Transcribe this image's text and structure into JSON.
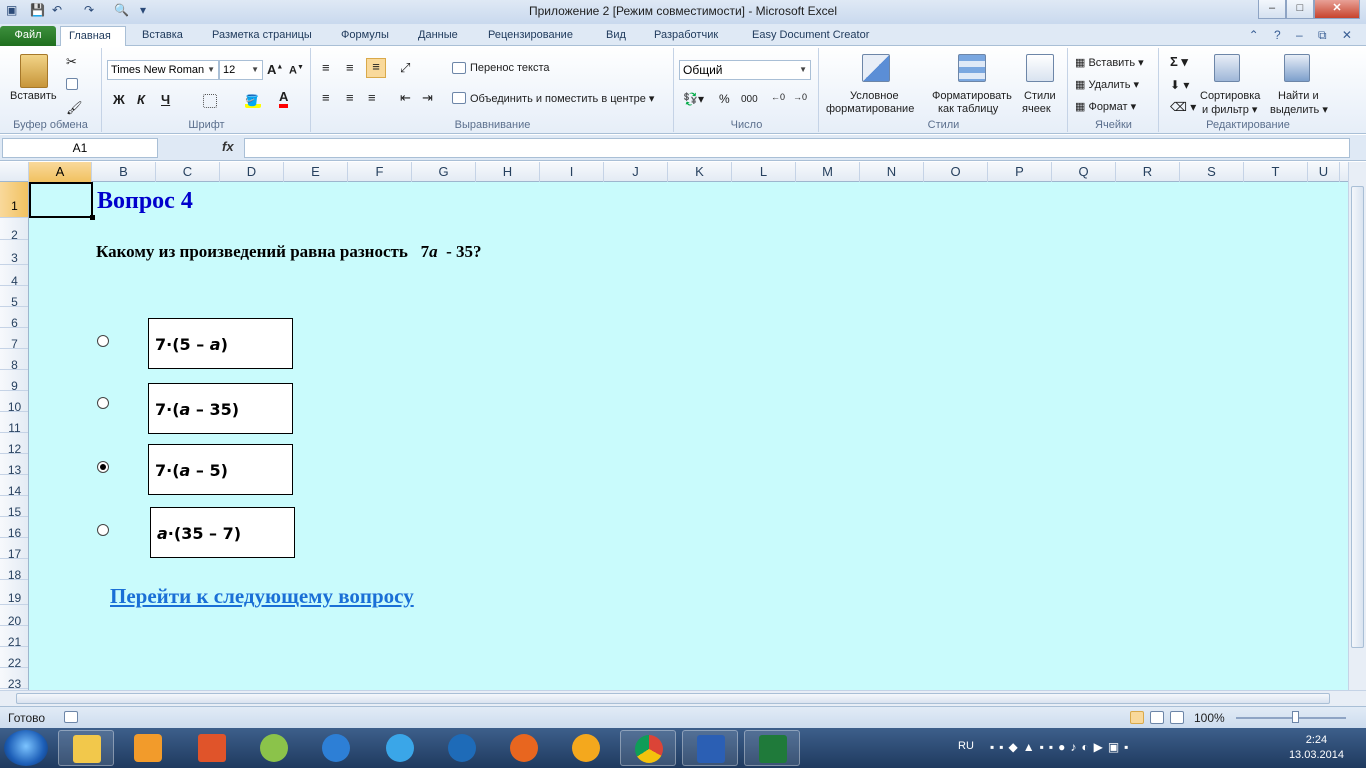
{
  "window": {
    "title": "Приложение 2  [Режим совместимости]  -  Microsoft Excel",
    "controls": [
      "–",
      "□",
      "✕"
    ]
  },
  "ribbon_tabs": [
    "Файл",
    "Главная",
    "Вставка",
    "Разметка страницы",
    "Формулы",
    "Данные",
    "Рецензирование",
    "Вид",
    "Разработчик",
    "Easy Document Creator"
  ],
  "ribbon": {
    "clipboard": {
      "paste": "Вставить",
      "label": "Буфер обмена"
    },
    "font": {
      "name": "Times New Roman",
      "size": "12",
      "bold": "Ж",
      "italic": "К",
      "underline": "Ч",
      "label": "Шрифт"
    },
    "alignment": {
      "wrap": "Перенос текста",
      "merge": "Объединить и поместить в центре",
      "label": "Выравнивание"
    },
    "number": {
      "format": "Общий",
      "percent": "%",
      "thousands": "000",
      "label": "Число"
    },
    "styles": {
      "conditional_1": "Условное",
      "conditional_2": "форматирование",
      "as_table_1": "Форматировать",
      "as_table_2": "как таблицу",
      "cell_styles_1": "Стили",
      "cell_styles_2": "ячеек",
      "label": "Стили"
    },
    "cells": {
      "insert": "Вставить",
      "delete": "Удалить",
      "format": "Формат",
      "label": "Ячейки"
    },
    "editing": {
      "sort_1": "Сортировка",
      "sort_2": "и фильтр",
      "find_1": "Найти и",
      "find_2": "выделить",
      "label": "Редактирование"
    }
  },
  "formula_bar": {
    "name_box": "A1",
    "fx": "fx",
    "content": ""
  },
  "columns": [
    "A",
    "B",
    "C",
    "D",
    "E",
    "F",
    "G",
    "H",
    "I",
    "J",
    "K",
    "L",
    "M",
    "N",
    "O",
    "P",
    "Q",
    "R",
    "S",
    "T",
    "U"
  ],
  "rows": [
    "1",
    "2",
    "3",
    "4",
    "5",
    "6",
    "7",
    "8",
    "9",
    "10",
    "11",
    "12",
    "13",
    "14",
    "15",
    "16",
    "17",
    "18",
    "19",
    "20",
    "21",
    "22",
    "23"
  ],
  "sheet": {
    "question_title": "Вопрос 4",
    "question_text": "Какому из произведений равна разность   7",
    "question_var": "a",
    "question_rest": "  - 35?",
    "answers": [
      {
        "pre": "7·(5 – ",
        "var": "a",
        "post": ")",
        "selected": false
      },
      {
        "pre": "7·(",
        "var": "a",
        "post": " – 35)",
        "selected": false
      },
      {
        "pre": "7·(",
        "var": "a",
        "post": " – 5)",
        "selected": true
      },
      {
        "pre": "",
        "var": "a",
        "post": "·(35 – 7)",
        "selected": false
      }
    ],
    "next_link": "Перейти к следующему вопросу"
  },
  "status": {
    "ready": "Готово",
    "zoom": "100%"
  },
  "taskbar": {
    "lang": "RU",
    "time": "2:24",
    "date": "13.03.2014"
  },
  "colors": {
    "sheet_bg": "#c9fbfc",
    "title_blue": "#0000cc",
    "link_blue": "#1a6fd6",
    "file_tab": "#2a7d2a"
  }
}
